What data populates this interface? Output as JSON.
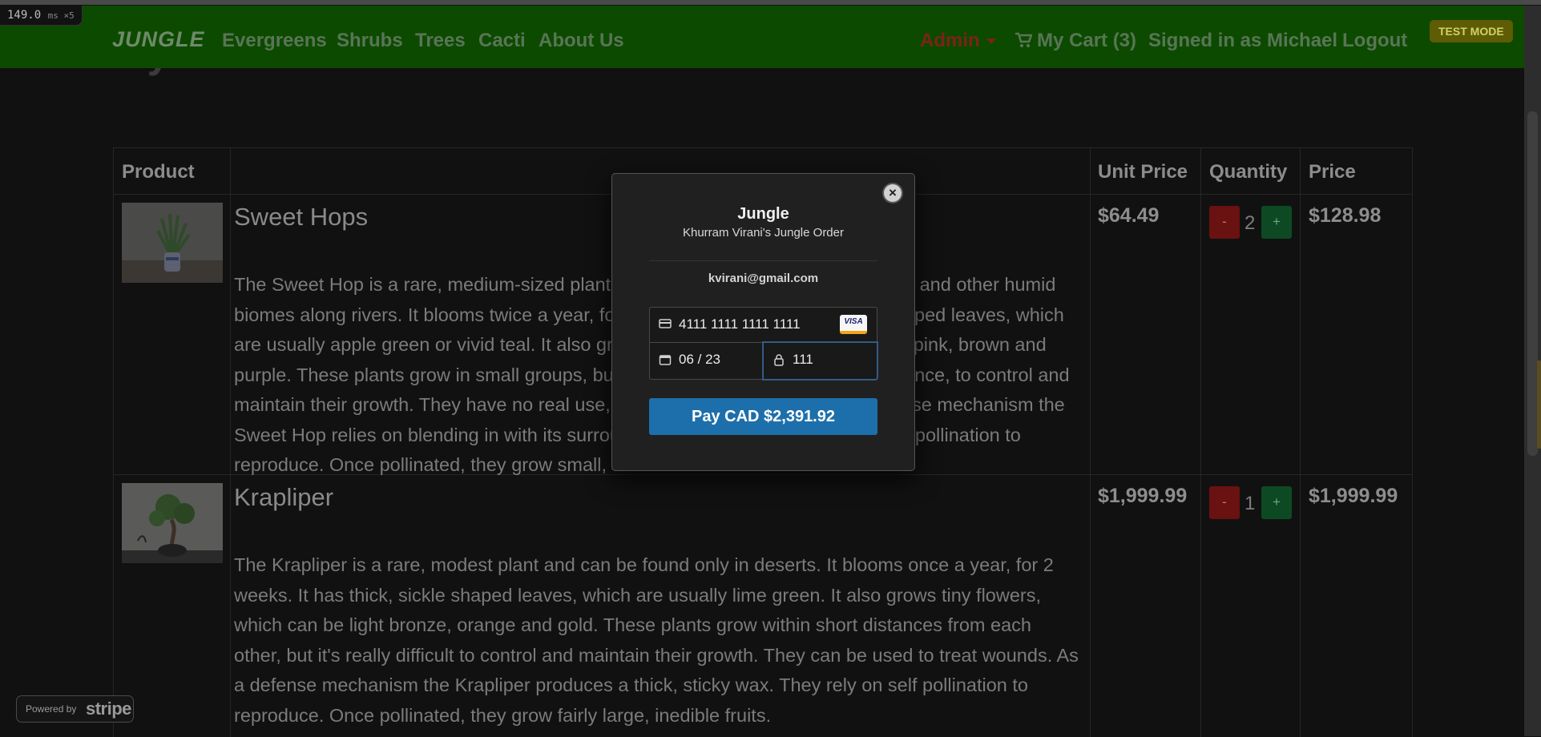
{
  "perf": {
    "ms": "149.0",
    "unit": "ms ×5"
  },
  "nav": {
    "brand": "JUNGLE",
    "links": [
      "Evergreens",
      "Shrubs",
      "Trees",
      "Cacti",
      "About Us"
    ],
    "admin": "Admin",
    "cart": "My Cart (3)",
    "signed_in": "Signed in as Michael",
    "logout": "Logout",
    "test_mode": "TEST MODE"
  },
  "page": {
    "title": "My Cart"
  },
  "table": {
    "headers": {
      "product": "Product",
      "unit_price": "Unit Price",
      "quantity": "Quantity",
      "price": "Price"
    },
    "rows": [
      {
        "name": "Sweet Hops",
        "description": "The Sweet Hop is a rare, medium-sized plant and can be found only in rainforests and other humid biomes along rivers. It blooms twice a year, for 2 months. It has thin, diamond shaped leaves, which are usually apple green or vivid teal. It also grows tiny flowers, which can be dark pink, brown and purple. These plants grow in small groups, but it's hard, especially without experience, to control and maintain their growth. They have no real use, besides their aesthetics. As a defense mechanism the Sweet Hop relies on blending in with its surroundings to survive. They rely on self pollination to reproduce. Once pollinated, they grow small, delicious nuts.",
        "unit_price": "$64.49",
        "minus": "-",
        "quantity": "2",
        "plus": "+",
        "price": "$128.98"
      },
      {
        "name": "Krapliper",
        "description": "The Krapliper is a rare, modest plant and can be found only in deserts. It blooms once a year, for 2 weeks. It has thick, sickle shaped leaves, which are usually lime green. It also grows tiny flowers, which can be light bronze, orange and gold. These plants grow within short distances from each other, but it's really difficult to control and maintain their growth. They can be used to treat wounds. As a defense mechanism the Krapliper produces a thick, sticky wax. They rely on self pollination to reproduce. Once pollinated, they grow fairly large, inedible fruits.",
        "unit_price": "$1,999.99",
        "minus": "-",
        "quantity": "1",
        "plus": "+",
        "price": "$1,999.99"
      }
    ]
  },
  "checkout": {
    "close": "×",
    "title": "Jungle",
    "subtitle": "Khurram Virani's Jungle Order",
    "email": "kvirani@gmail.com",
    "card_number": "4111 1111 1111 1111",
    "card_brand": "VISA",
    "expiry": "06 / 23",
    "cvc": "111",
    "pay_label": "Pay CAD $2,391.92"
  },
  "stripe_badge": {
    "powered_by": "Powered by",
    "brand": "stripe"
  },
  "colors": {
    "navbar": "#0c4a00",
    "pay_button": "#1d6fab",
    "test_mode": "#5e5c04"
  }
}
